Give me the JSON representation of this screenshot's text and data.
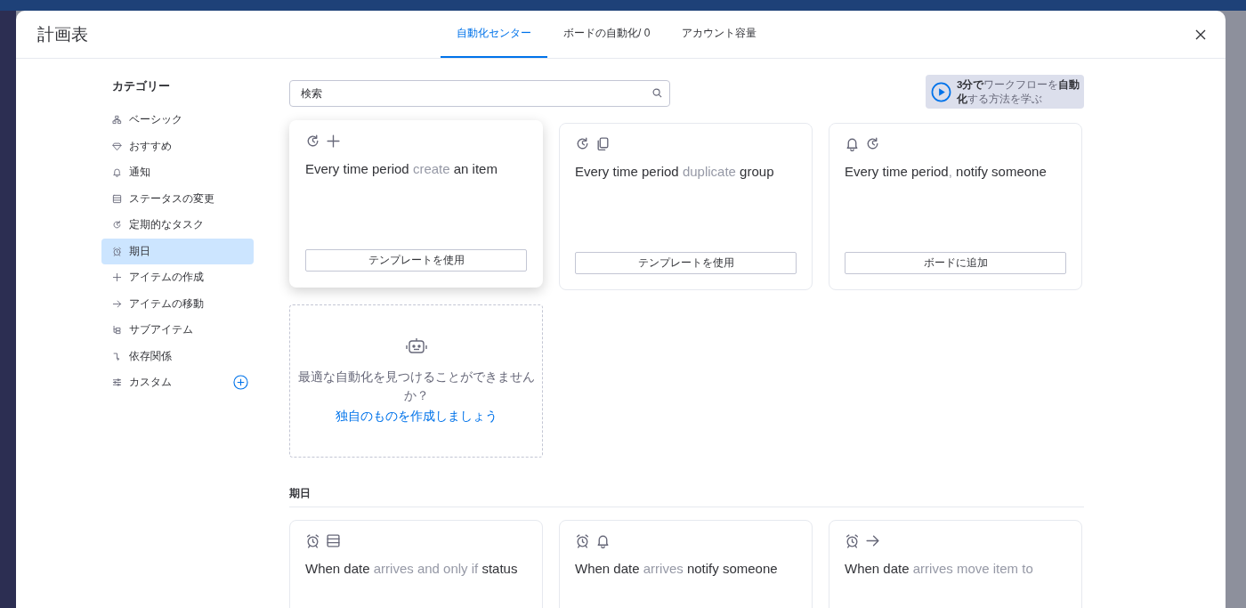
{
  "modal": {
    "title": "計画表",
    "tabs": [
      {
        "label": "自動化センター",
        "selected": true
      },
      {
        "label": "ボードの自動化/ 0",
        "selected": false
      },
      {
        "label": "アカウント容量",
        "selected": false
      }
    ]
  },
  "sidebar": {
    "heading": "カテゴリー",
    "items": [
      {
        "label": "ベーシック",
        "kind": "sitemap",
        "selected": false
      },
      {
        "label": "おすすめ",
        "kind": "gem",
        "selected": false
      },
      {
        "label": "通知",
        "kind": "bell",
        "selected": false
      },
      {
        "label": "ステータスの変更",
        "kind": "list",
        "selected": false
      },
      {
        "label": "定期的なタスク",
        "kind": "recur",
        "selected": false
      },
      {
        "label": "期日",
        "kind": "alarm",
        "selected": true
      },
      {
        "label": "アイテムの作成",
        "kind": "plus",
        "selected": false
      },
      {
        "label": "アイテムの移動",
        "kind": "arrow",
        "selected": false
      },
      {
        "label": "サブアイテム",
        "kind": "subitems",
        "selected": false
      },
      {
        "label": "依存関係",
        "kind": "dependency",
        "selected": false
      },
      {
        "label": "カスタム",
        "kind": "sliders",
        "selected": false,
        "add_button": true
      }
    ]
  },
  "search": {
    "placeholder": "検索"
  },
  "promo": {
    "text": "**3分で**ワークフローを**自動化**する方法を学ぶ"
  },
  "templates": [
    {
      "icons": [
        {
          "kind": "recur"
        },
        {
          "kind": "plus"
        }
      ],
      "title": "**Every time period** create **an item**",
      "button": "テンプレートを使用",
      "hovered": true
    },
    {
      "icons": [
        {
          "kind": "recur"
        },
        {
          "kind": "duplicate"
        }
      ],
      "title": "**Every time period** duplicate **group**",
      "button": "テンプレートを使用",
      "hovered": false
    },
    {
      "icons": [
        {
          "kind": "bell"
        },
        {
          "kind": "recur"
        }
      ],
      "title": "**Every time period**, **notify someone**",
      "button": "ボードに追加",
      "hovered": false
    }
  ],
  "custom_card": {
    "text": "最適な自動化を見つけることができませんか？",
    "link": "独自のものを作成しましょう"
  },
  "section": {
    "heading": "期日",
    "cards": [
      {
        "icons": [
          {
            "kind": "alarm"
          },
          {
            "kind": "list"
          }
        ],
        "title": "**When date** arrives and only if **status**",
        "hovered": false
      },
      {
        "icons": [
          {
            "kind": "alarm"
          },
          {
            "kind": "bell"
          }
        ],
        "title": "**When date** arrives **notify someone**",
        "hovered": false
      },
      {
        "icons": [
          {
            "kind": "alarm"
          },
          {
            "kind": "arrow"
          }
        ],
        "title": "**When date** arrives move item to",
        "hovered": false
      }
    ]
  }
}
